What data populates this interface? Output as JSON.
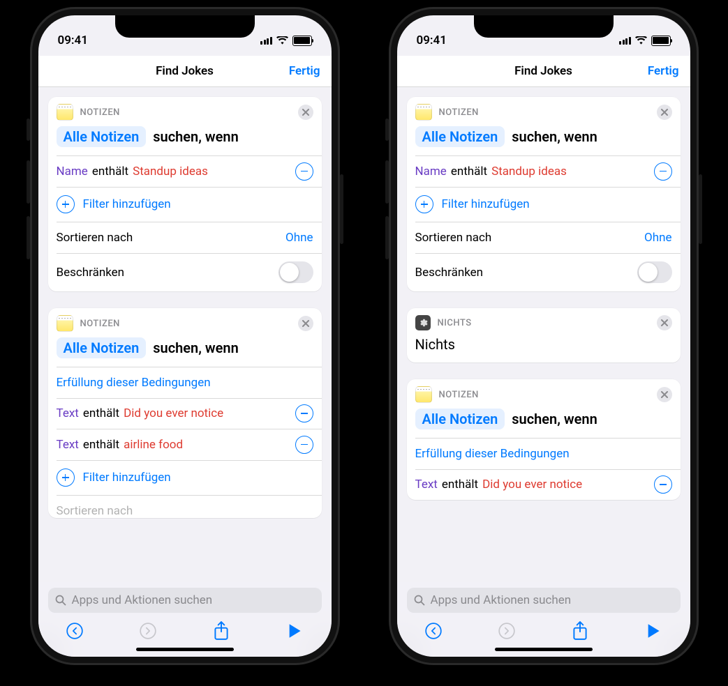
{
  "status": {
    "time": "09:41"
  },
  "nav": {
    "title": "Find Jokes",
    "done": "Fertig"
  },
  "labels": {
    "notizen": "NOTIZEN",
    "nichts": "NICHTS",
    "add_filter": "Filter hinzufügen",
    "sort_by": "Sortieren nach",
    "limit": "Beschränken",
    "conditions": "Erfüllung dieser Bedingungen"
  },
  "actions": {
    "all_notes": "Alle Notizen",
    "search_when": "suchen, wenn",
    "nothing": "Nichts"
  },
  "filters": {
    "f1": {
      "field": "Name",
      "op": "enthält",
      "val": "Standup ideas"
    },
    "f2": {
      "field": "Text",
      "op": "enthält",
      "val": "Did you ever notice"
    },
    "f3": {
      "field": "Text",
      "op": "enthält",
      "val": "airline food"
    }
  },
  "vals": {
    "none": "Ohne"
  },
  "search": {
    "placeholder": "Apps und Aktionen suchen"
  }
}
